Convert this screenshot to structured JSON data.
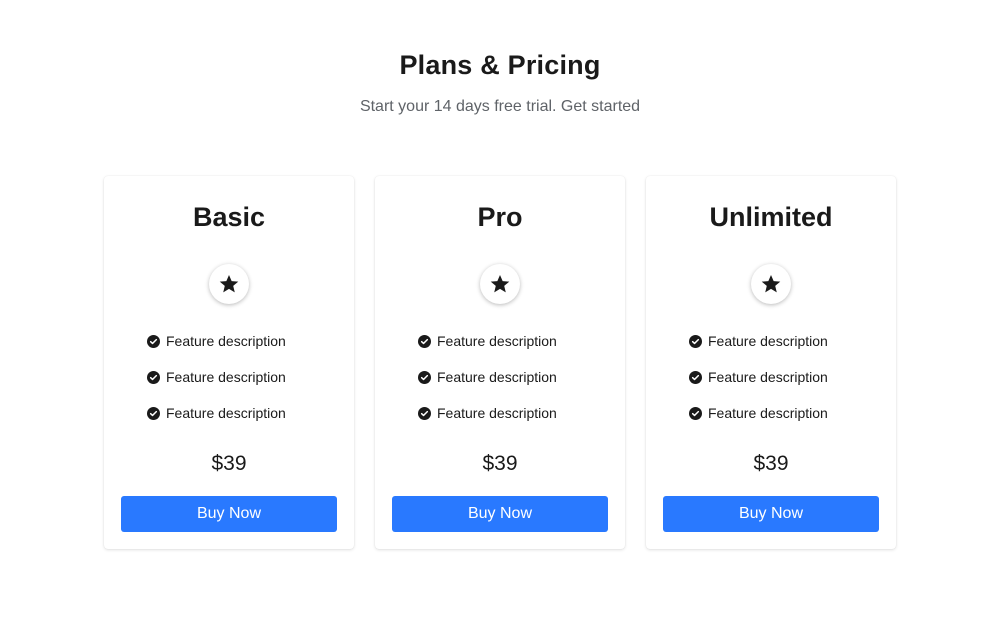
{
  "header": {
    "title": "Plans & Pricing",
    "subtitle": "Start your 14 days free trial. Get started"
  },
  "plans": [
    {
      "name": "Basic",
      "icon": "star-icon",
      "features": [
        "Feature description",
        "Feature description",
        "Feature description"
      ],
      "price": "$39",
      "button_label": "Buy Now"
    },
    {
      "name": "Pro",
      "icon": "star-icon",
      "features": [
        "Feature description",
        "Feature description",
        "Feature description"
      ],
      "price": "$39",
      "button_label": "Buy Now"
    },
    {
      "name": "Unlimited",
      "icon": "star-icon",
      "features": [
        "Feature description",
        "Feature description",
        "Feature description"
      ],
      "price": "$39",
      "button_label": "Buy Now"
    }
  ],
  "colors": {
    "accent": "#2979ff",
    "text": "#1a1a1a",
    "muted": "#5f6368",
    "background": "#ffffff"
  }
}
